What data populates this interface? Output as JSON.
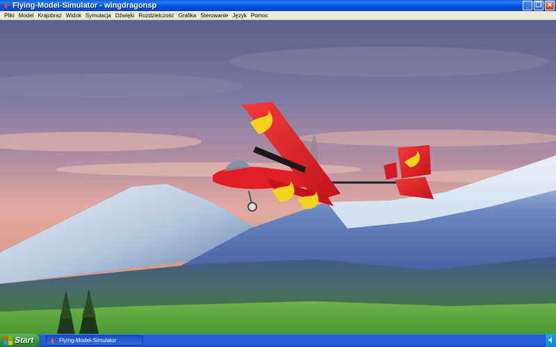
{
  "window": {
    "title": "Flying-Model-Simulator - wingdragonsp",
    "minimize_icon": "minimize-icon",
    "maximize_icon": "restore-icon",
    "close_icon": "close-icon"
  },
  "menu": {
    "items": [
      "Pliki",
      "Model",
      "Krajobraz",
      "Widok",
      "Symulacja",
      "Dźwięki",
      "Rozdzielczość",
      "Grafika",
      "Sterowanie",
      "Język",
      "Pomoc"
    ]
  },
  "taskbar": {
    "start_label": "Start",
    "task_label": "Flying-Model-Simulator",
    "tray_icon": "speaker-icon"
  },
  "colors": {
    "titlebar": "#0054e3",
    "menubar": "#ece9d8",
    "taskbar": "#245edb",
    "start_button": "#3a9a3a",
    "plane_body": "#e8202a"
  }
}
